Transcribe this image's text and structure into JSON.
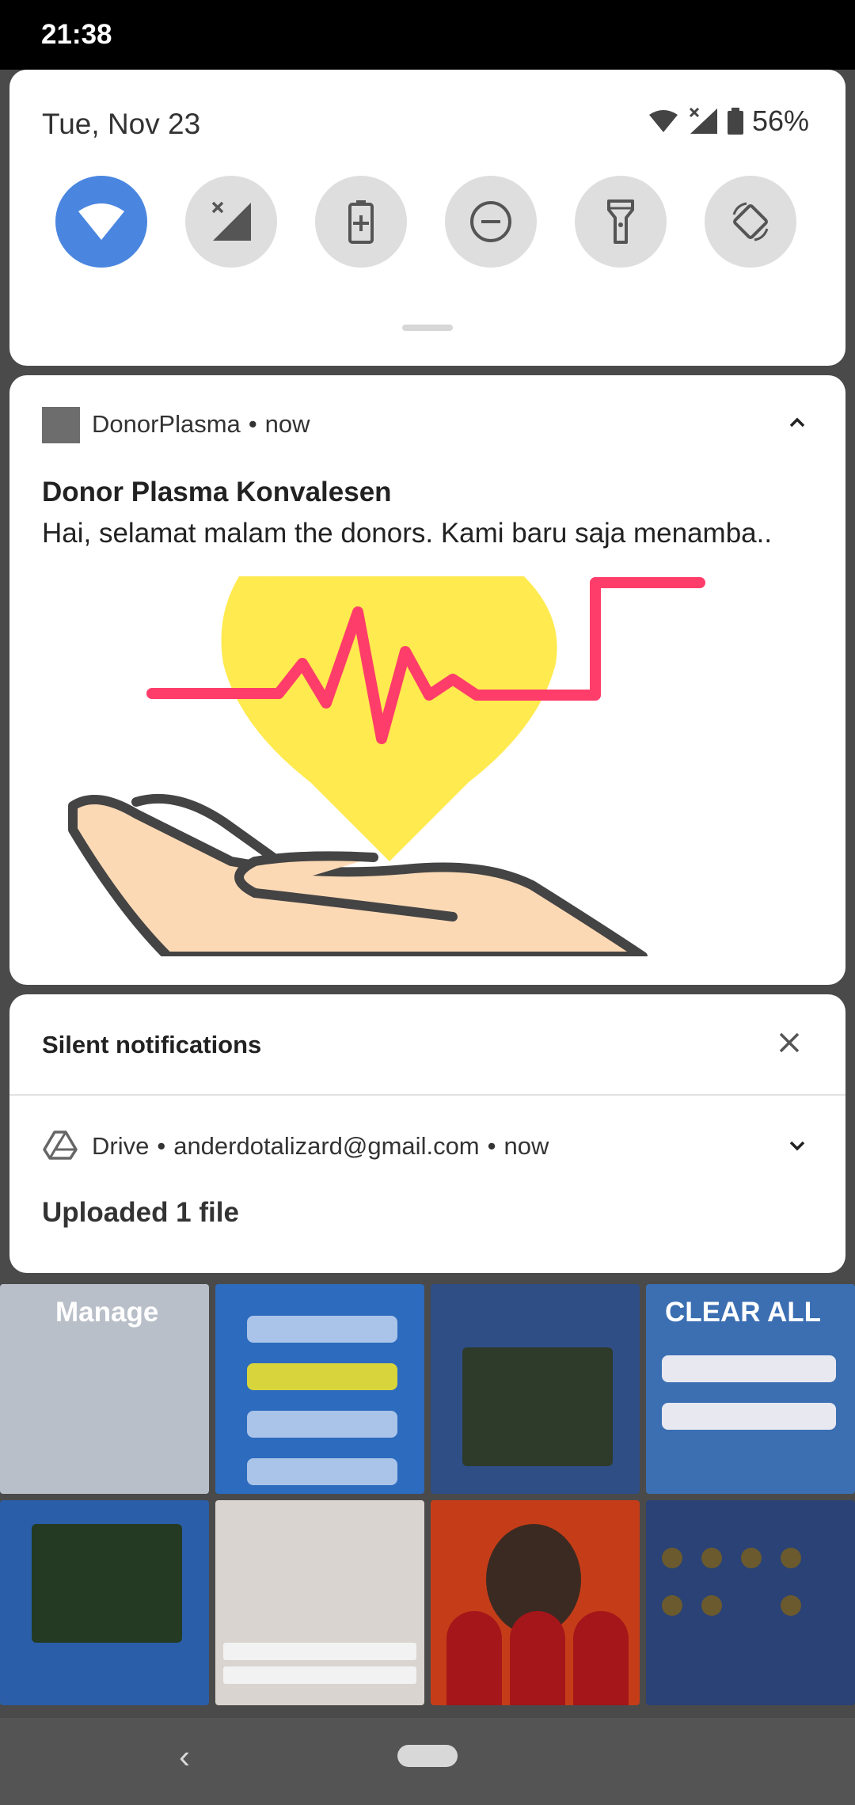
{
  "status_bar": {
    "time": "21:38"
  },
  "quick_settings": {
    "date": "Tue, Nov 23",
    "battery_percent": "56%",
    "tiles": [
      {
        "name": "wifi",
        "icon": "wifi-icon",
        "active": true
      },
      {
        "name": "mobile-data",
        "icon": "signal-off-icon",
        "active": false
      },
      {
        "name": "battery-saver",
        "icon": "battery-saver-icon",
        "active": false
      },
      {
        "name": "do-not-disturb",
        "icon": "dnd-icon",
        "active": false
      },
      {
        "name": "flashlight",
        "icon": "flashlight-icon",
        "active": false
      },
      {
        "name": "auto-rotate",
        "icon": "rotate-icon",
        "active": false
      }
    ],
    "accent_color": "#4a86e0"
  },
  "notification": {
    "app_name": "DonorPlasma",
    "separator": "•",
    "time": "now",
    "title": "Donor Plasma Konvalesen",
    "text": "Hai, selamat malam the donors. Kami baru saja menamba.."
  },
  "silent": {
    "title": "Silent notifications",
    "drive": {
      "app_name": "Drive",
      "separator": "•",
      "account": "anderdotalizard@gmail.com",
      "time": "now",
      "text": "Uploaded 1 file"
    }
  },
  "recents": {
    "manage_label": "Manage",
    "clear_all_label": "CLEAR ALL"
  }
}
